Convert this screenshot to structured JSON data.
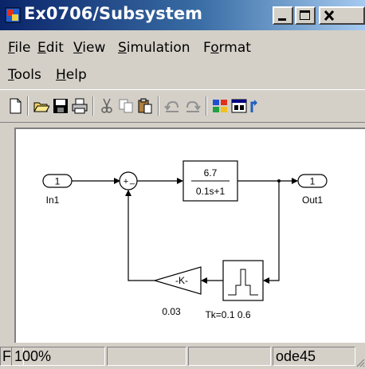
{
  "window": {
    "title": "Ex0706/Subsystem",
    "icons": {
      "app": "simulink-model-icon",
      "minimize": "minimize-icon",
      "maximize": "maximize-icon",
      "close": "close-icon"
    }
  },
  "menu": {
    "row1": [
      {
        "label": "File",
        "accel": "F",
        "rest": "ile"
      },
      {
        "label": "Edit",
        "accel": "E",
        "rest": "dit"
      },
      {
        "label": "View",
        "accel": "V",
        "rest": "iew"
      },
      {
        "label": "Simulation",
        "accel": "S",
        "rest": "imulation"
      },
      {
        "label": "Format",
        "pre": "F",
        "accel": "o",
        "rest": "rmat"
      }
    ],
    "row2": [
      {
        "label": "Tools",
        "accel": "T",
        "rest": "ools"
      },
      {
        "label": "Help",
        "accel": "H",
        "rest": "elp"
      }
    ]
  },
  "toolbar": {
    "buttons": [
      "new-icon",
      "open-icon",
      "save-icon",
      "print-icon",
      "cut-icon",
      "copy-icon",
      "paste-icon",
      "undo-icon",
      "redo-icon",
      "library-browser-icon",
      "model-explorer-icon",
      "go-to-parent-icon"
    ]
  },
  "diagram": {
    "blocks": {
      "in_port": {
        "number": "1",
        "label": "In1"
      },
      "out_port": {
        "number": "1",
        "label": "Out1"
      },
      "sum_signs": {
        "top": "+",
        "left": "+",
        "bottom": "_"
      },
      "transfer_fcn": {
        "numerator": "6.7",
        "denominator": "0.1s+1"
      },
      "gain": {
        "value": "-K-",
        "label": "0.03"
      },
      "sampler": {
        "label": "Tk=0.1 0.6"
      }
    }
  },
  "status": {
    "left": "F",
    "zoom": "100%",
    "solver": "ode45"
  }
}
